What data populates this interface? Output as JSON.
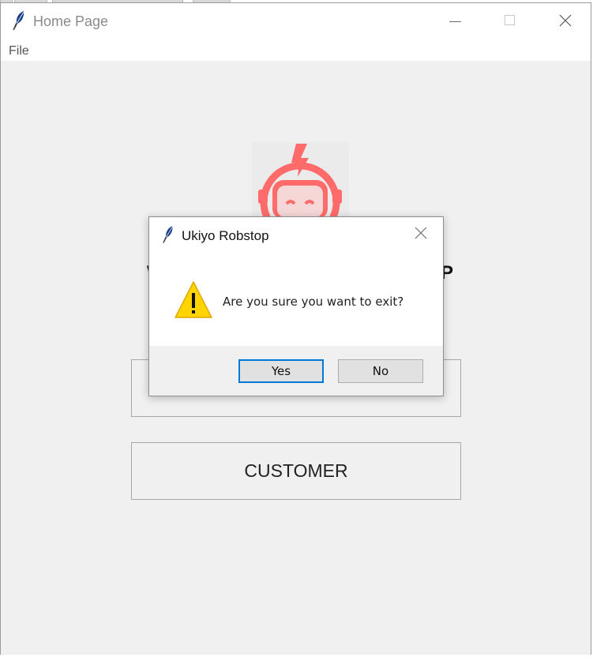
{
  "window": {
    "title": "Home Page",
    "menu": [
      "File"
    ]
  },
  "main": {
    "heading_left": "W",
    "heading_right": "P",
    "buttons": [
      {
        "label": ""
      },
      {
        "label": "CUSTOMER"
      }
    ]
  },
  "dialog": {
    "title": "Ukiyo Robstop",
    "message": "Are you sure you want to exit?",
    "yes_label": "Yes",
    "no_label": "No",
    "icon": "warning-icon"
  },
  "colors": {
    "logo": "#ff6b6b",
    "accent": "#0078d7",
    "warning": "#ffd400"
  }
}
